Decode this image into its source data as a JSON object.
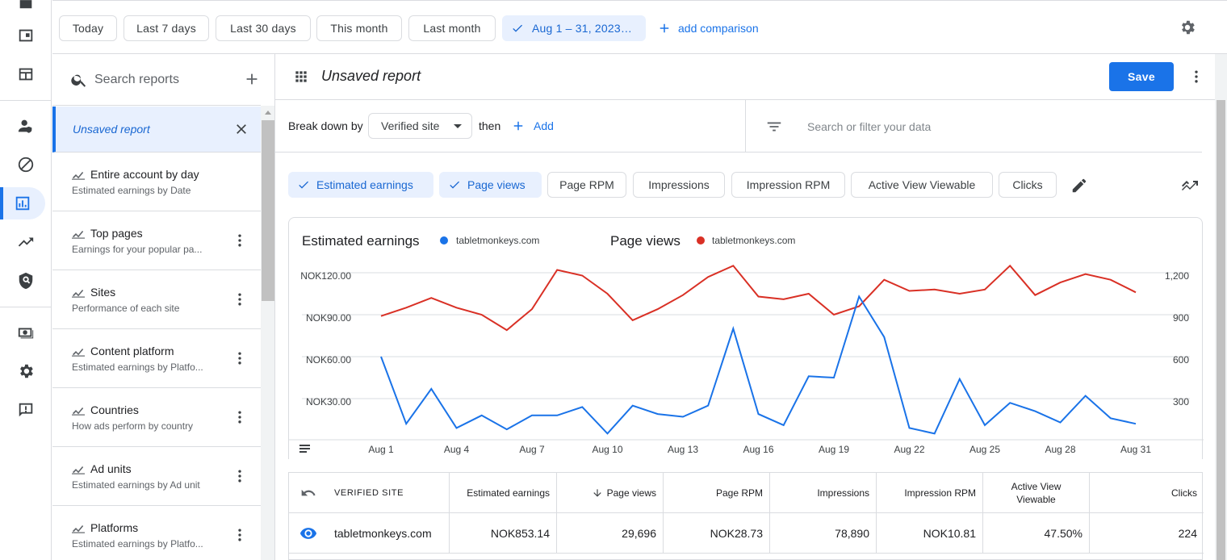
{
  "topbar": {
    "date_chips": [
      "Today",
      "Last 7 days",
      "Last 30 days",
      "This month",
      "Last month"
    ],
    "selected_range": "Aug 1 – 31, 2023…",
    "add_comparison": "add comparison"
  },
  "panel": {
    "search_placeholder": "Search reports",
    "unsaved_item": "Unsaved report",
    "reports": [
      {
        "title": "Entire account by day",
        "subtitle": "Estimated earnings by Date"
      },
      {
        "title": "Top pages",
        "subtitle": "Earnings for your popular pa..."
      },
      {
        "title": "Sites",
        "subtitle": "Performance of each site"
      },
      {
        "title": "Content platform",
        "subtitle": "Estimated earnings by Platfo..."
      },
      {
        "title": "Countries",
        "subtitle": "How ads perform by country"
      },
      {
        "title": "Ad units",
        "subtitle": "Estimated earnings by Ad unit"
      },
      {
        "title": "Platforms",
        "subtitle": "Estimated earnings by Platfo..."
      }
    ]
  },
  "report": {
    "title": "Unsaved report",
    "save_label": "Save",
    "breakdown_label": "Break down by",
    "breakdown_value": "Verified site",
    "then_label": "then",
    "add_label": "Add",
    "filter_placeholder": "Search or filter your data"
  },
  "metrics": {
    "selected": [
      "Estimated earnings",
      "Page views"
    ],
    "unselected": [
      "Page RPM",
      "Impressions",
      "Impression RPM",
      "Active View Viewable",
      "Clicks"
    ]
  },
  "colors": {
    "accent": "#1a73e8",
    "earnings": "#1a73e8",
    "pageviews": "#d93025"
  },
  "chart_data": {
    "type": "line",
    "legend": [
      {
        "metric": "Estimated earnings",
        "site": "tabletmonkeys.com",
        "color": "#1a73e8"
      },
      {
        "metric": "Page views",
        "site": "tabletmonkeys.com",
        "color": "#d93025"
      }
    ],
    "x": [
      "Aug 1",
      "Aug 2",
      "Aug 3",
      "Aug 4",
      "Aug 5",
      "Aug 6",
      "Aug 7",
      "Aug 8",
      "Aug 9",
      "Aug 10",
      "Aug 11",
      "Aug 12",
      "Aug 13",
      "Aug 14",
      "Aug 15",
      "Aug 16",
      "Aug 17",
      "Aug 18",
      "Aug 19",
      "Aug 20",
      "Aug 21",
      "Aug 22",
      "Aug 23",
      "Aug 24",
      "Aug 25",
      "Aug 26",
      "Aug 27",
      "Aug 28",
      "Aug 29",
      "Aug 30",
      "Aug 31"
    ],
    "x_tick_labels": [
      "Aug 1",
      "Aug 4",
      "Aug 7",
      "Aug 10",
      "Aug 13",
      "Aug 16",
      "Aug 19",
      "Aug 22",
      "Aug 25",
      "Aug 28",
      "Aug 31"
    ],
    "y_left_ticks": [
      "NOK30.00",
      "NOK60.00",
      "NOK90.00",
      "NOK120.00"
    ],
    "y_right_ticks": [
      "300",
      "600",
      "900",
      "1,200"
    ],
    "ylim_left": [
      0,
      120
    ],
    "ylim_right": [
      0,
      1200
    ],
    "series": [
      {
        "name": "Estimated earnings",
        "axis": "left",
        "values": [
          60,
          12,
          37,
          9,
          18,
          8,
          18,
          18,
          24,
          5,
          25,
          19,
          17,
          25,
          80,
          19,
          11,
          46,
          45,
          103,
          74,
          9,
          5,
          44,
          11,
          27,
          21,
          13,
          32,
          16,
          12
        ]
      },
      {
        "name": "Page views",
        "axis": "right",
        "values": [
          890,
          950,
          1020,
          950,
          900,
          790,
          940,
          1220,
          1180,
          1050,
          860,
          940,
          1040,
          1170,
          1250,
          1030,
          1010,
          1050,
          900,
          960,
          1150,
          1070,
          1080,
          1050,
          1080,
          1250,
          1040,
          1130,
          1190,
          1150,
          1060
        ]
      }
    ]
  },
  "table": {
    "headers": [
      "VERIFIED SITE",
      "Estimated earnings",
      "Page views",
      "Page RPM",
      "Impressions",
      "Impression RPM",
      "Active View Viewable",
      "Clicks"
    ],
    "row": [
      "tabletmonkeys.com",
      "NOK853.14",
      "29,696",
      "NOK28.73",
      "78,890",
      "NOK10.81",
      "47.50%",
      "224"
    ]
  }
}
